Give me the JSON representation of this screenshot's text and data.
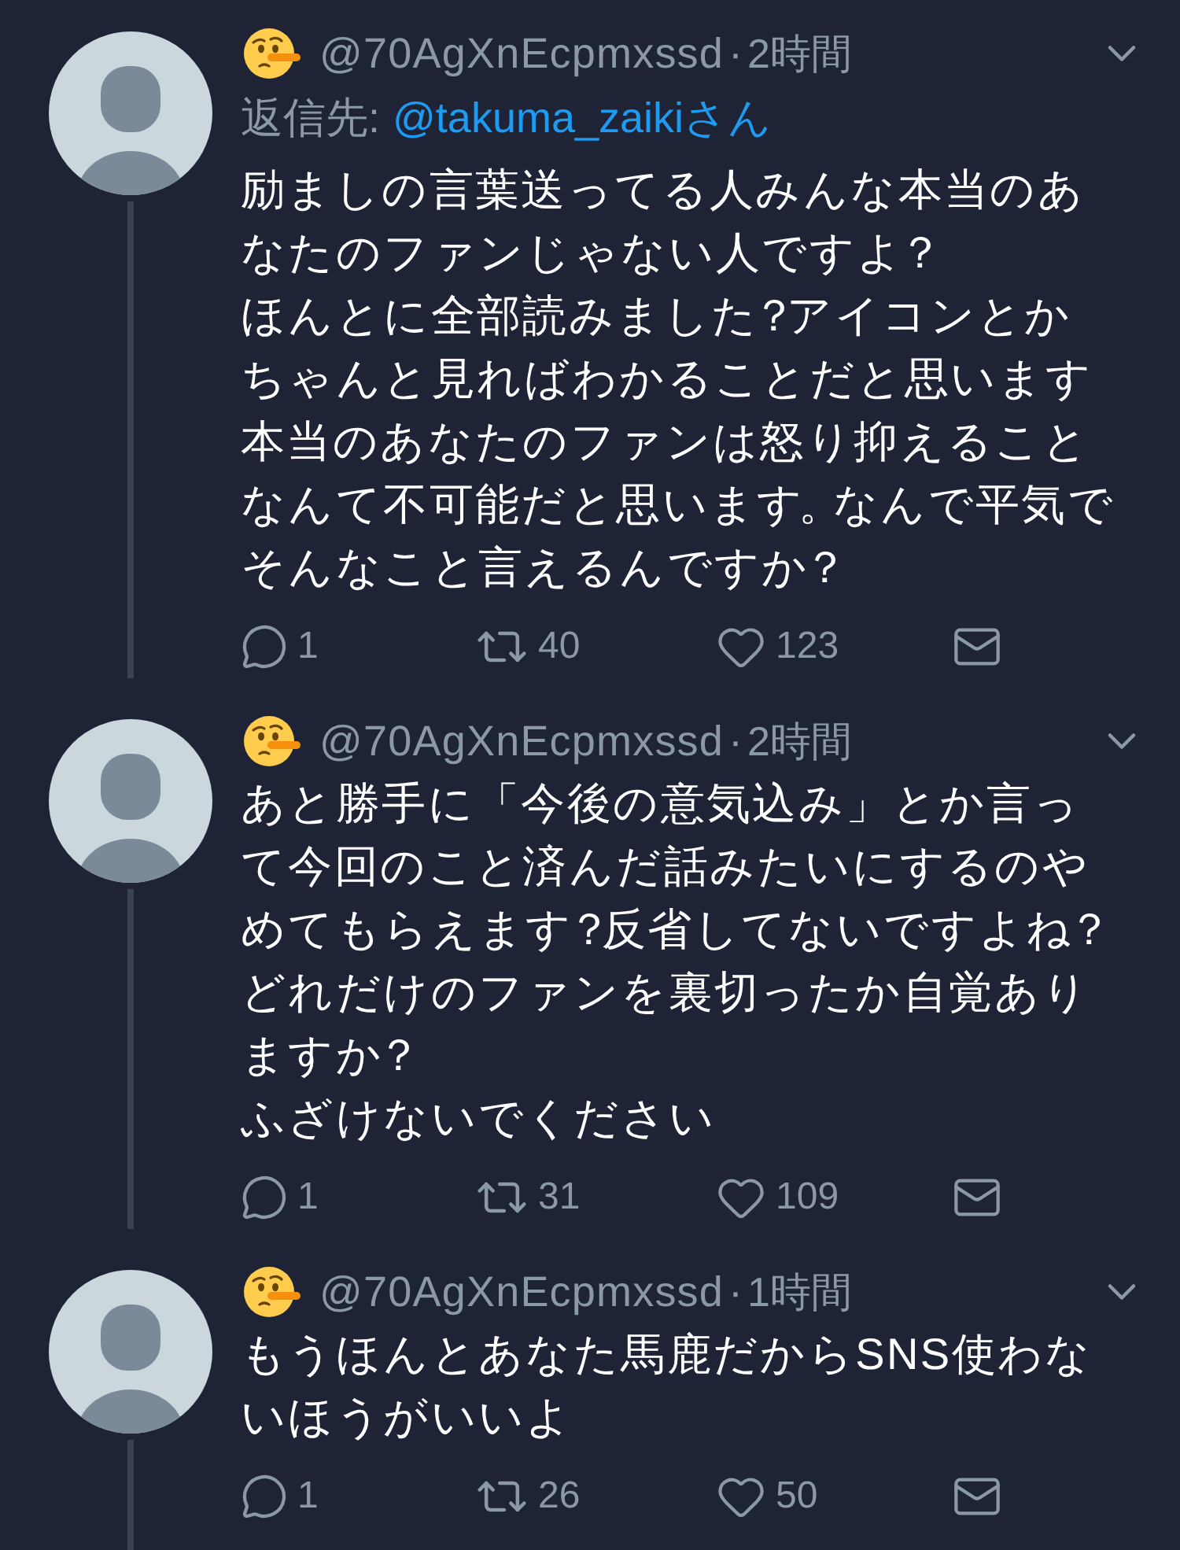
{
  "tweets": [
    {
      "handle": "@70AgXnEcpmxssd",
      "separator": "·",
      "time": "2時間",
      "reply_to": {
        "label": "返信先:",
        "mention": "@takuma_zaikiさん"
      },
      "paragraphs": [
        "励ましの言葉送ってる人みんな本当のあなたのファンじゃない人ですよ？",
        "ほんとに全部読みました？アイコンとかちゃんと見ればわかることだと思います本当のあなたのファンは怒り抑えることなんて不可能だと思います。なんで平気でそんなこと言えるんですか？"
      ],
      "actions": {
        "replies": "1",
        "retweets": "40",
        "likes": "123"
      }
    },
    {
      "handle": "@70AgXnEcpmxssd",
      "separator": "·",
      "time": "2時間",
      "paragraphs": [
        "あと勝手に「今後の意気込み」とか言って今回のこと済んだ話みたいにするのやめてもらえます？反省してないですよね？どれだけのファンを裏切ったか自覚ありますか？",
        "ふざけないでください"
      ],
      "actions": {
        "replies": "1",
        "retweets": "31",
        "likes": "109"
      }
    },
    {
      "handle": "@70AgXnEcpmxssd",
      "separator": "·",
      "time": "1時間",
      "paragraphs": [
        "もうほんとあなた馬鹿だからSNS使わないほうがいいよ"
      ],
      "actions": {
        "replies": "1",
        "retweets": "26",
        "likes": "50"
      }
    }
  ]
}
